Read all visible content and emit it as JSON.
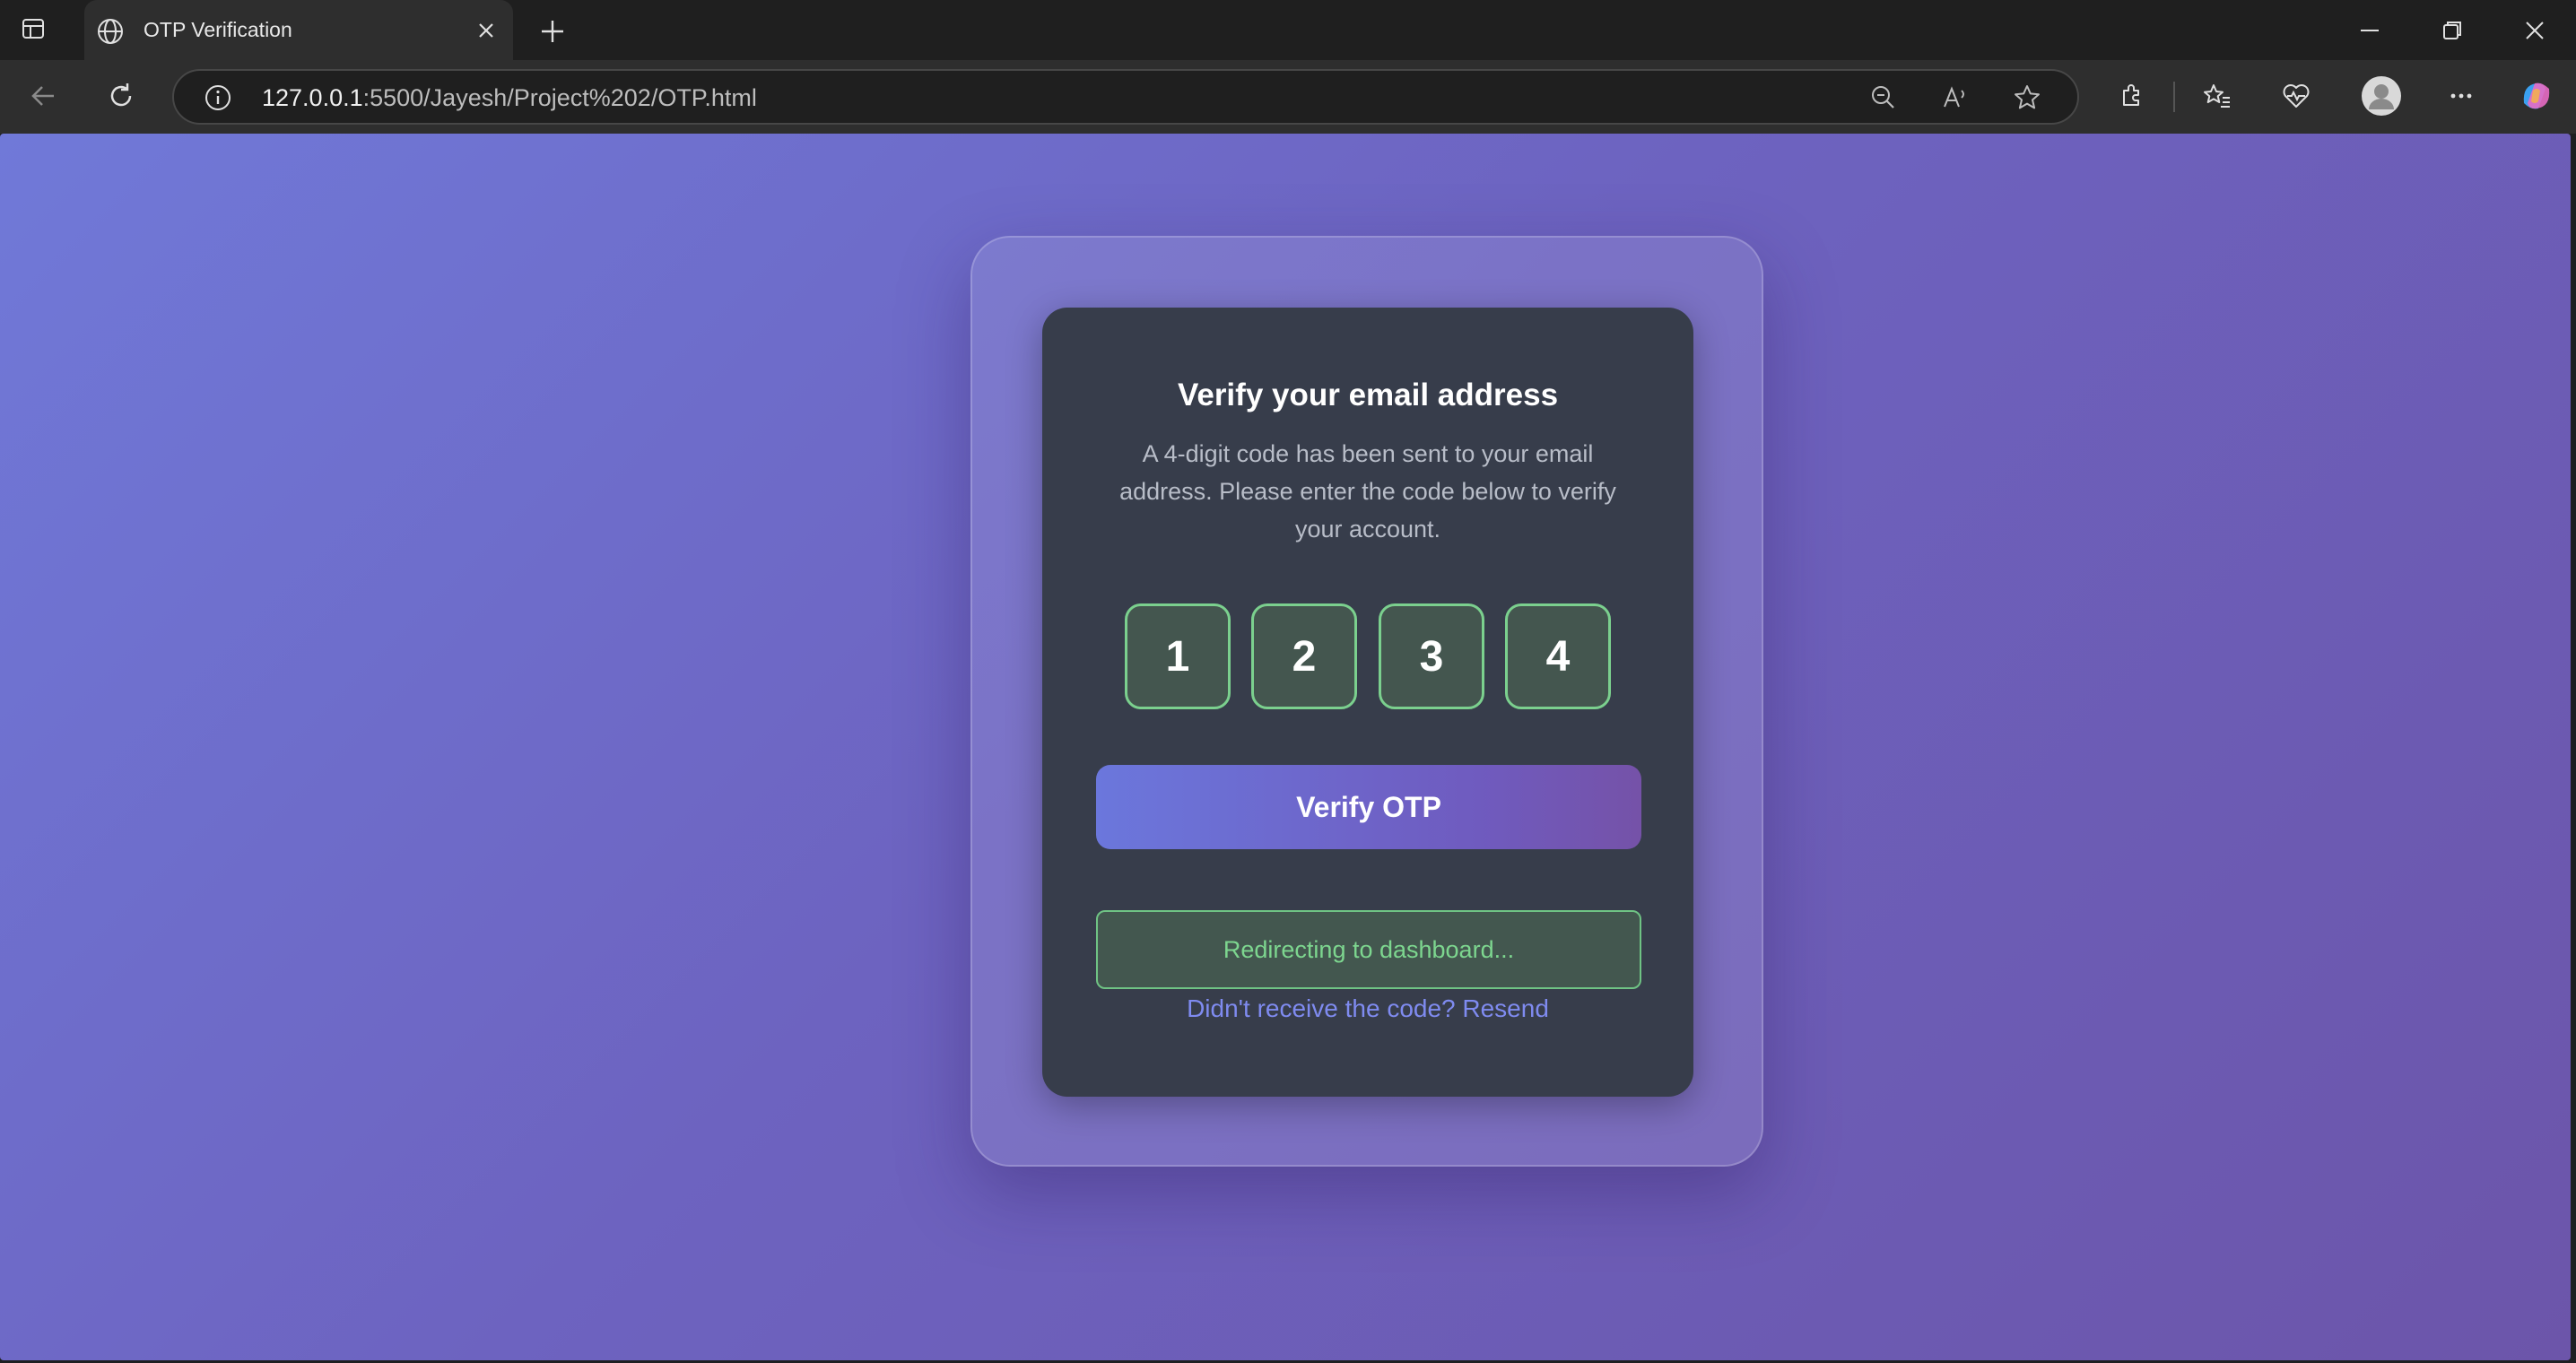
{
  "browser": {
    "tab": {
      "title": "OTP Verification"
    },
    "address": {
      "host": "127.0.0.1",
      "path": ":5500/Jayesh/Project%202/OTP.html"
    }
  },
  "card": {
    "heading": "Verify your email address",
    "description": "A 4-digit code has been sent to your email address. Please enter the code below to verify your account.",
    "otp_digits": [
      "1",
      "2",
      "3",
      "4"
    ],
    "verify_button": "Verify OTP",
    "status_message": "Redirecting to dashboard...",
    "resend_prompt": "Didn't receive the code?",
    "resend_link": "Resend"
  },
  "colors": {
    "accent": "#6b77dc",
    "success": "#7dd68f",
    "card_bg": "#373d4b"
  }
}
